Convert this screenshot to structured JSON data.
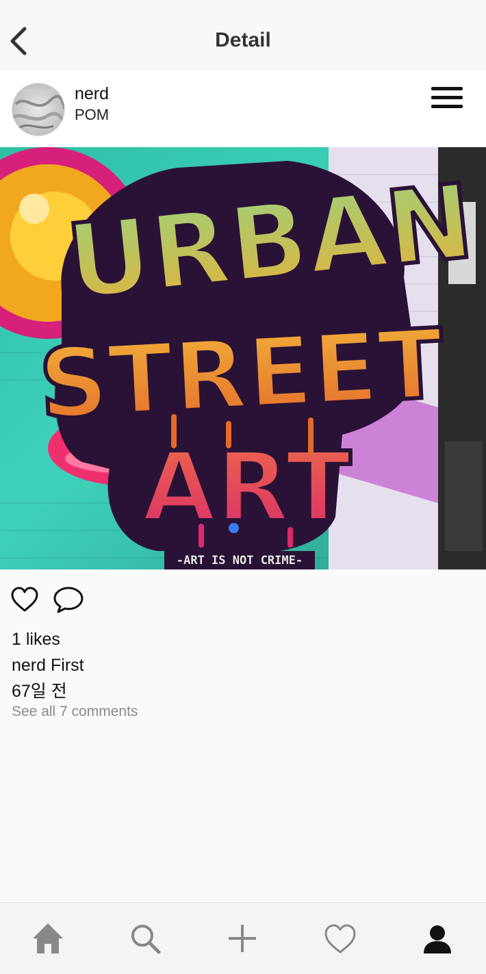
{
  "header": {
    "title": "Detail",
    "back_icon": "chevron-left-icon"
  },
  "post": {
    "username": "nerd",
    "subtitle": "POM",
    "menu_icon": "hamburger-menu-icon",
    "image_text": {
      "line1": "URBAN",
      "line2": "STREET",
      "line3": "ART",
      "tagline": "-ART IS NOT CRIME-"
    },
    "likes_text": "1 likes",
    "caption_user": "nerd",
    "caption_text": "First",
    "time_text": "67일 전",
    "comments_link": "See all 7 comments"
  },
  "tabs": [
    {
      "icon": "home-icon"
    },
    {
      "icon": "search-icon"
    },
    {
      "icon": "plus-icon"
    },
    {
      "icon": "heart-icon"
    },
    {
      "icon": "profile-icon"
    }
  ],
  "colors": {
    "accent_dot": "#3b7bf5",
    "muted_text": "#8a8a8a"
  }
}
